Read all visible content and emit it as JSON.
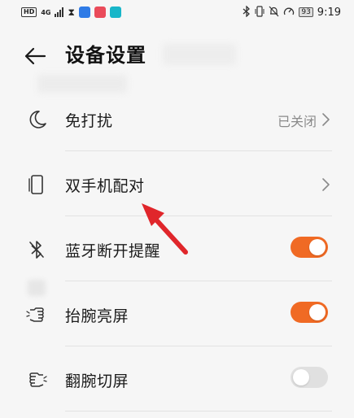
{
  "status_bar": {
    "hd": "HD",
    "network": "4G",
    "battery": "93",
    "time": "9:19",
    "app_colors": [
      "#2f7be6",
      "#ea4b5a",
      "#18b6c9"
    ]
  },
  "header": {
    "title": "设备设置",
    "back_icon": "arrow-left-icon"
  },
  "settings": [
    {
      "label": "免打扰",
      "icon": "moon-icon",
      "value": "已关闭",
      "control": "chevron"
    },
    {
      "label": "双手机配对",
      "icon": "phone-icon",
      "value": "",
      "control": "chevron"
    },
    {
      "label": "蓝牙断开提醒",
      "icon": "bluetooth-off-icon",
      "control": "toggle",
      "on": true
    },
    {
      "label": "抬腕亮屏",
      "icon": "raise-wrist-icon",
      "control": "toggle",
      "on": true
    },
    {
      "label": "翻腕切屏",
      "icon": "flip-wrist-icon",
      "control": "toggle",
      "on": false
    }
  ],
  "colors": {
    "accent": "#f06a24",
    "annotation_arrow": "#e0262b",
    "toggle_off": "#e0e0e0"
  }
}
